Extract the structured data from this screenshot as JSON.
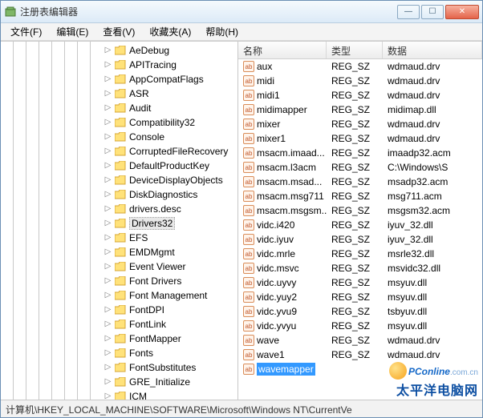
{
  "window": {
    "title": "注册表编辑器"
  },
  "menu": {
    "file": "文件(F)",
    "edit": "编辑(E)",
    "view": "查看(V)",
    "favorites": "收藏夹(A)",
    "help": "帮助(H)"
  },
  "tree": {
    "selected": "Drivers32",
    "nodes": [
      "AeDebug",
      "APITracing",
      "AppCompatFlags",
      "ASR",
      "Audit",
      "Compatibility32",
      "Console",
      "CorruptedFileRecovery",
      "DefaultProductKey",
      "DeviceDisplayObjects",
      "DiskDiagnostics",
      "drivers.desc",
      "Drivers32",
      "EFS",
      "EMDMgmt",
      "Event Viewer",
      "Font Drivers",
      "Font Management",
      "FontDPI",
      "FontLink",
      "FontMapper",
      "Fonts",
      "FontSubstitutes",
      "GRE_Initialize",
      "ICM"
    ]
  },
  "list": {
    "headers": {
      "name": "名称",
      "type": "类型",
      "data": "数据"
    },
    "selected": "wavemapper",
    "rows": [
      {
        "name": "aux",
        "type": "REG_SZ",
        "data": "wdmaud.drv"
      },
      {
        "name": "midi",
        "type": "REG_SZ",
        "data": "wdmaud.drv"
      },
      {
        "name": "midi1",
        "type": "REG_SZ",
        "data": "wdmaud.drv"
      },
      {
        "name": "midimapper",
        "type": "REG_SZ",
        "data": "midimap.dll"
      },
      {
        "name": "mixer",
        "type": "REG_SZ",
        "data": "wdmaud.drv"
      },
      {
        "name": "mixer1",
        "type": "REG_SZ",
        "data": "wdmaud.drv"
      },
      {
        "name": "msacm.imaad...",
        "type": "REG_SZ",
        "data": "imaadp32.acm"
      },
      {
        "name": "msacm.l3acm",
        "type": "REG_SZ",
        "data": "C:\\Windows\\S"
      },
      {
        "name": "msacm.msad...",
        "type": "REG_SZ",
        "data": "msadp32.acm"
      },
      {
        "name": "msacm.msg711",
        "type": "REG_SZ",
        "data": "msg711.acm"
      },
      {
        "name": "msacm.msgsm...",
        "type": "REG_SZ",
        "data": "msgsm32.acm"
      },
      {
        "name": "vidc.i420",
        "type": "REG_SZ",
        "data": "iyuv_32.dll"
      },
      {
        "name": "vidc.iyuv",
        "type": "REG_SZ",
        "data": "iyuv_32.dll"
      },
      {
        "name": "vidc.mrle",
        "type": "REG_SZ",
        "data": "msrle32.dll"
      },
      {
        "name": "vidc.msvc",
        "type": "REG_SZ",
        "data": "msvidc32.dll"
      },
      {
        "name": "vidc.uyvy",
        "type": "REG_SZ",
        "data": "msyuv.dll"
      },
      {
        "name": "vidc.yuy2",
        "type": "REG_SZ",
        "data": "msyuv.dll"
      },
      {
        "name": "vidc.yvu9",
        "type": "REG_SZ",
        "data": "tsbyuv.dll"
      },
      {
        "name": "vidc.yvyu",
        "type": "REG_SZ",
        "data": "msyuv.dll"
      },
      {
        "name": "wave",
        "type": "REG_SZ",
        "data": "wdmaud.drv"
      },
      {
        "name": "wave1",
        "type": "REG_SZ",
        "data": "wdmaud.drv"
      },
      {
        "name": "wavemapper",
        "type": "",
        "data": ""
      }
    ]
  },
  "statusbar": {
    "path": "计算机\\HKEY_LOCAL_MACHINE\\SOFTWARE\\Microsoft\\Windows NT\\CurrentVe"
  },
  "watermark": {
    "line1": "PConline",
    "line1_suffix": ".com.cn",
    "line2": "太平洋电脑网"
  }
}
